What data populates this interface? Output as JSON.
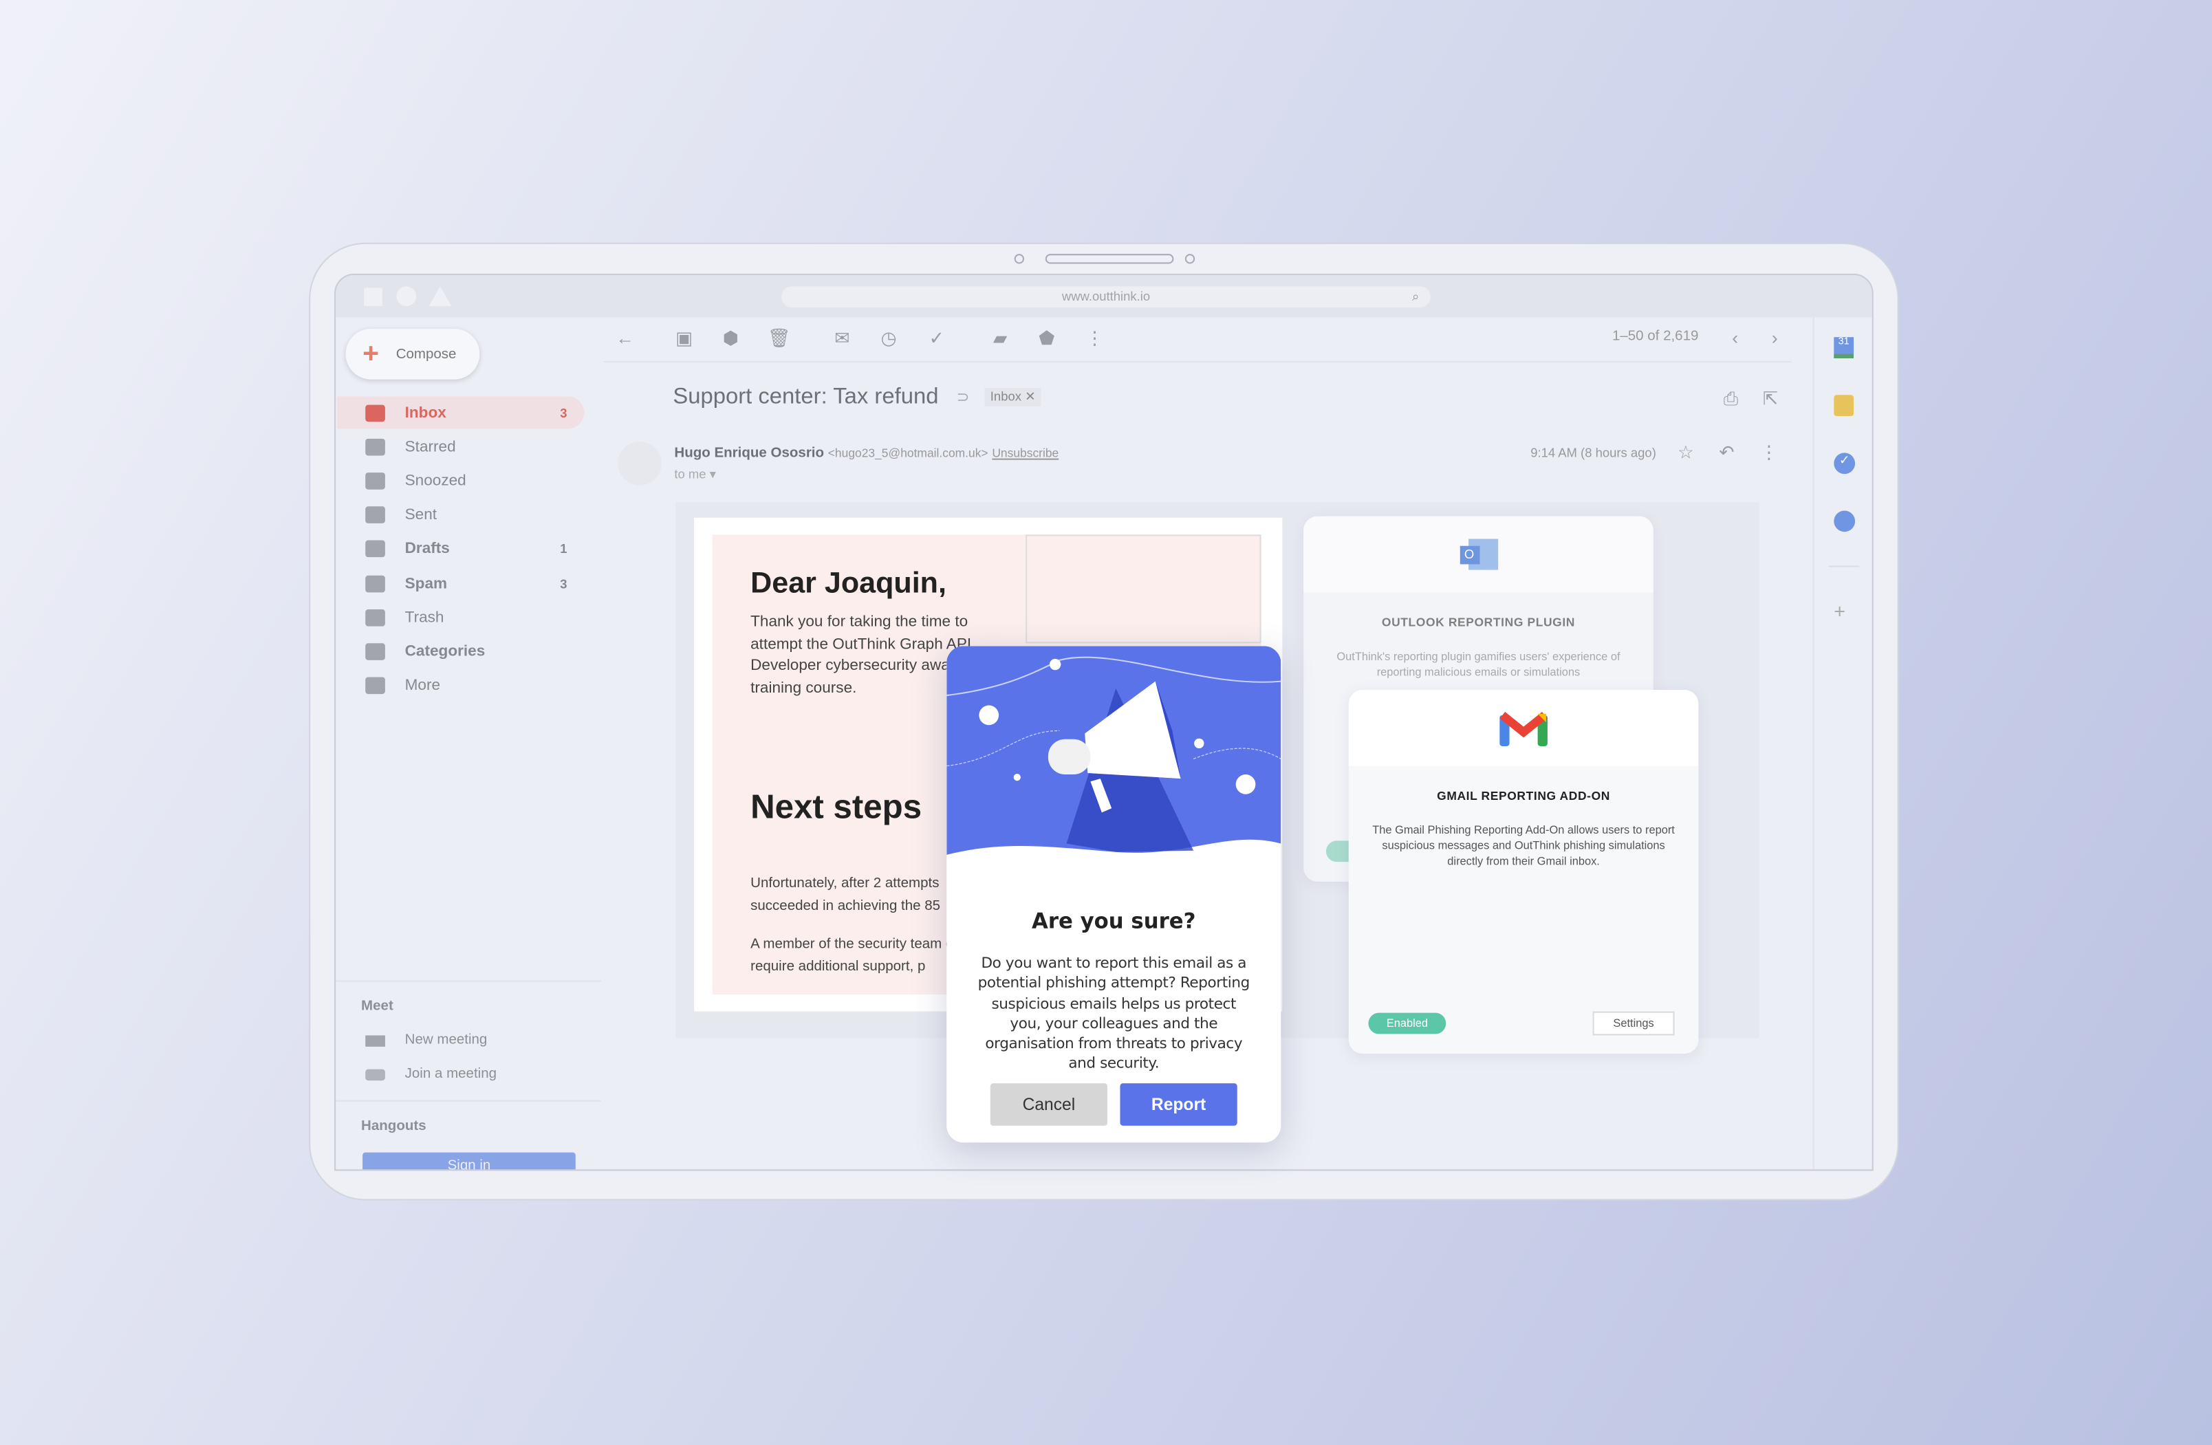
{
  "browser": {
    "url": "www.outthink.io"
  },
  "sidebar": {
    "compose": "Compose",
    "items": [
      {
        "label": "Inbox",
        "count": "3",
        "icon": "inbox-icon"
      },
      {
        "label": "Starred",
        "count": "",
        "icon": "star-icon"
      },
      {
        "label": "Snoozed",
        "count": "",
        "icon": "clock-icon"
      },
      {
        "label": "Sent",
        "count": "",
        "icon": "send-icon"
      },
      {
        "label": "Drafts",
        "count": "1",
        "icon": "draft-icon"
      },
      {
        "label": "Spam",
        "count": "3",
        "icon": "spam-icon"
      },
      {
        "label": "Trash",
        "count": "",
        "icon": "trash-icon"
      },
      {
        "label": "Categories",
        "count": "",
        "icon": "label-icon"
      },
      {
        "label": "More",
        "count": "",
        "icon": "chevron-down-icon"
      }
    ],
    "meet": {
      "title": "Meet",
      "new_meeting": "New meeting",
      "join": "Join a meeting"
    },
    "hangouts": {
      "title": "Hangouts",
      "sign_in": "Sign in"
    }
  },
  "toolbar": {
    "pagination": "1–50 of 2,619"
  },
  "email": {
    "subject": "Support center: Tax refund",
    "label": "Inbox",
    "sender_name": "Hugo Enrique Ososrio",
    "sender_email": "<hugo23_5@hotmail.com.uk>",
    "unsubscribe": "Unsubscribe",
    "to": "to me",
    "time": "9:14 AM (8 hours ago)",
    "body": {
      "greeting": "Dear Joaquin,",
      "intro": "Thank you for taking the time to attempt the OutThink Graph API Developer cybersecurity awa training course.",
      "heading": "Next steps",
      "p1": "Unfortunately, after 2 attempts succeeded in achieving the 85",
      "p2": "A member of the security team or require additional support, p"
    }
  },
  "outlook_card": {
    "title": "OUTLOOK REPORTING PLUGIN",
    "desc": "OutThink's reporting plugin gamifies users' experience of reporting malicious emails or simulations"
  },
  "gmail_card": {
    "title": "GMAIL REPORTING ADD-ON",
    "desc": "The Gmail Phishing Reporting Add-On allows users to report suspicious messages and OutThink phishing simulations directly from their Gmail inbox.",
    "status": "Enabled",
    "settings": "Settings"
  },
  "modal": {
    "title": "Are you sure?",
    "body": "Do you want to report this email as a potential phishing attempt? Reporting suspicious emails helps us protect you, your colleagues and the organisation from threats to privacy and security.",
    "cancel": "Cancel",
    "report": "Report"
  },
  "colors": {
    "accent": "#5a73e8",
    "enabled": "#5cc7a8",
    "inbox": "#d9665f",
    "email_bg": "#fbeeec"
  }
}
